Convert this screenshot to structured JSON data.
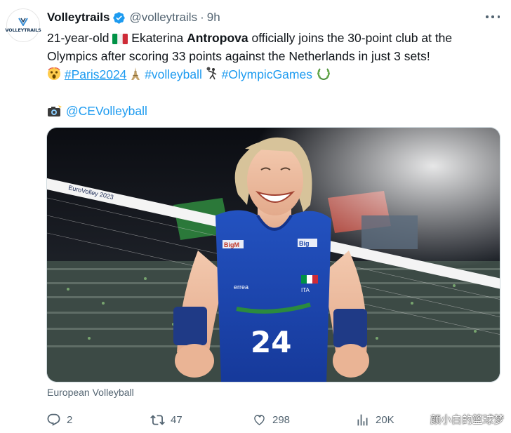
{
  "tweet": {
    "avatar_text": "VOLLEYTRAILS",
    "author_name": "Volleytrails",
    "handle": "@volleytrails",
    "separator": "·",
    "time": "9h",
    "text": {
      "l1_a": "21-year-old",
      "l1_b": "Ekaterina",
      "l1_bold": "Antropova",
      "l1_c": "officially joins the 30-point club at the",
      "l2": "Olympics after scoring 33 points against the Netherlands in just 3 sets!",
      "hashtag_paris": "#Paris2024",
      "hashtag_volleyball": "#volleyball",
      "hashtag_olympic": "#OlympicGames",
      "credit": "@CEVolleyball"
    },
    "media_caption": "European Volleyball",
    "media": {
      "banner_text": "EuroVolley 2023",
      "jersey_number": "24",
      "sponsor_text": "BigM",
      "brand_text": "errea",
      "country_code": "ITA"
    },
    "actions": {
      "replies": "2",
      "reposts": "47",
      "likes": "298",
      "views": "20K"
    },
    "watermark": "颜小白的篮球梦"
  },
  "colors": {
    "link": "#1d9bf0",
    "muted": "#536471",
    "jersey": "#1d47a8",
    "verified": "#1d9bf0"
  }
}
